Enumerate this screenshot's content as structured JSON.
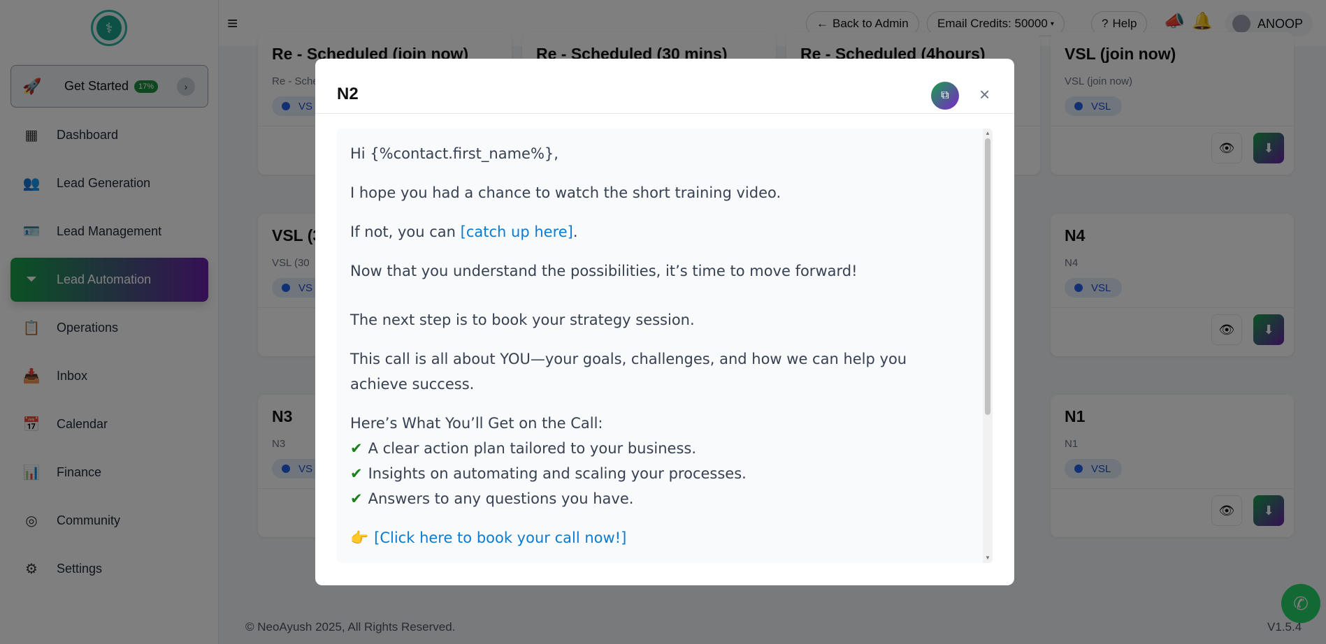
{
  "sidebar": {
    "get_started": {
      "label": "Get Started",
      "badge": "17%"
    },
    "items": [
      {
        "label": "Dashboard",
        "icon": "grid-icon"
      },
      {
        "label": "Lead Generation",
        "icon": "users-icon"
      },
      {
        "label": "Lead Management",
        "icon": "id-card-icon"
      },
      {
        "label": "Lead Automation",
        "icon": "funnel-icon"
      },
      {
        "label": "Operations",
        "icon": "clipboard-gear-icon"
      },
      {
        "label": "Inbox",
        "icon": "inbox-icon"
      },
      {
        "label": "Calendar",
        "icon": "calendar-icon"
      },
      {
        "label": "Finance",
        "icon": "finance-icon"
      },
      {
        "label": "Community",
        "icon": "community-icon"
      },
      {
        "label": "Settings",
        "icon": "gear-icon"
      }
    ]
  },
  "topbar": {
    "back_label": "Back to Admin",
    "credits_label": "Email Credits: 50000",
    "help_label": "Help",
    "user_name": "ANOOP"
  },
  "cards": [
    {
      "title": "Re - Scheduled (join now)",
      "subtitle": "Re - Sche",
      "tag": "VS"
    },
    {
      "title": "Re - Scheduled (30 mins)",
      "subtitle": "",
      "tag": ""
    },
    {
      "title": "Re - Scheduled (4hours)",
      "subtitle": "",
      "tag": ""
    },
    {
      "title": "VSL (join now)",
      "subtitle": "VSL (join now)",
      "tag": "VSL"
    },
    {
      "title": "VSL (3",
      "subtitle": "VSL (30",
      "tag": "VS"
    },
    {
      "title": "N4",
      "subtitle": "N4",
      "tag": "VSL"
    },
    {
      "title": "N3",
      "subtitle": "N3",
      "tag": "VS"
    },
    {
      "title": "N1",
      "subtitle": "N1",
      "tag": "VSL"
    }
  ],
  "footer": {
    "copyright": "© NeoAyush 2025, All Rights Reserved.",
    "version": "V1.5.4"
  },
  "modal": {
    "title": "N2",
    "greeting": "Hi {%contact.first_name%},",
    "p1": "I hope you had a chance to watch the short training video.",
    "p2_before": "If not, you can ",
    "p2_link": "[catch up here]",
    "p2_after": ".",
    "p3": "Now that you understand the possibilities, it’s time to move forward!",
    "p4": "The next step is to book your strategy session.",
    "p5": "This call is all about YOU—your goals, challenges, and how we can help you achieve success.",
    "list_heading": "Here’s What You’ll Get on the Call:",
    "list": [
      "A clear action plan tailored to your business.",
      "Insights on automating and scaling your processes.",
      "Answers to any questions you have."
    ],
    "cta_link": "[Click here to book your call now!]"
  },
  "colors": {
    "accent_start": "#16a34a",
    "accent_end": "#6b21a8",
    "link": "#0b7bd3"
  }
}
